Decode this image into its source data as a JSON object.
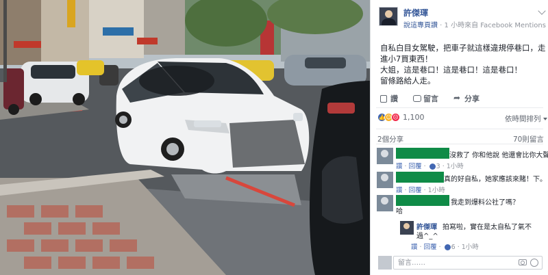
{
  "post": {
    "author": "許傑琿",
    "shared_label": "說這專頁讚",
    "time_source": " · 1 小時來自 Facebook Mentions · ",
    "text_lines": [
      "自私白目女駕駛，把車子就這樣違規停巷口，走",
      "進小7買東西！",
      "大姐，這是巷口！這是巷口！這是巷口！",
      "留條路給人走。"
    ]
  },
  "actions": {
    "like": "讚",
    "comment": "留言",
    "share": "分享"
  },
  "stats": {
    "reactions_count": "1,100",
    "sort_label": "依時間排列",
    "shares": "2個分享",
    "comments_count": "70則留言"
  },
  "comments": [
    {
      "text": "沒救了 你和他說 他還會比你大聲~(火)",
      "like": "讚",
      "reply": "回覆",
      "likes": "3",
      "time": "1小時"
    },
    {
      "text": "真的好自私，她家應該來賭！下。",
      "like": "讚",
      "reply": "回覆",
      "time": "1小時"
    },
    {
      "text": "我走到爆料公社了嗎？",
      "extra": "哈",
      "like": "讚",
      "reply": "回覆",
      "time": "1小時"
    }
  ],
  "reply": {
    "author": "許傑琿",
    "text_line1": "拍寫啦，實在是太自私了氣不",
    "text_line2": "過^_^",
    "like": "讚",
    "reply": "回覆",
    "likes": "6",
    "time": "1小時"
  },
  "composer": {
    "placeholder": "留言……"
  },
  "colors": {
    "link": "#365899",
    "redaction": "#0f8b47",
    "like": "#4267b2"
  }
}
